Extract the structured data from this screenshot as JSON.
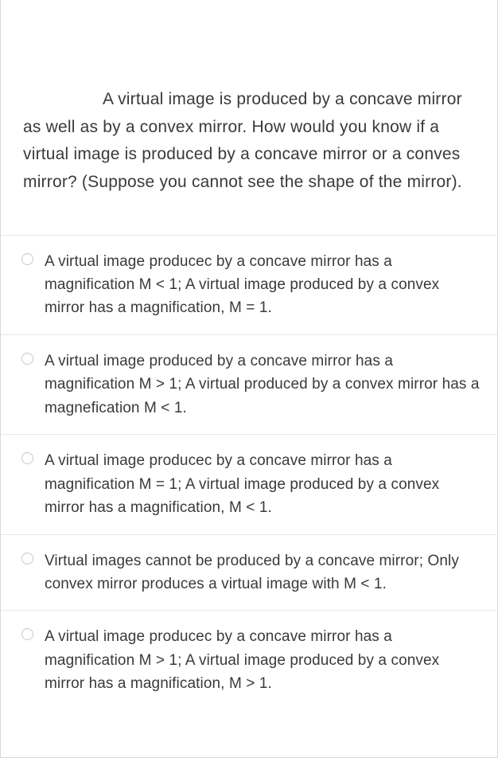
{
  "question": {
    "text": "A virtual image is produced by a concave mirror as well as by a convex mirror. How would you know if a virtual image is produced by a concave mirror or a conves mirror? (Suppose you cannot see the shape of the mirror)."
  },
  "options": [
    {
      "text": "A virtual image producec by a concave mirror has a magnification M < 1; A virtual image produced by a convex mirror has a magnification, M = 1."
    },
    {
      "text": "A virtual image produced by a concave mirror has a magnification M > 1; A virtual produced by a convex mirror has a magnefication M < 1."
    },
    {
      "text": "A virtual image producec by a concave mirror has a magnification M = 1; A virtual image produced by a convex mirror has a magnification, M < 1."
    },
    {
      "text": "Virtual images cannot be produced by a concave mirror; Only convex mirror produces a virtual image with M < 1."
    },
    {
      "text": "A virtual image producec by a concave mirror has a magnification M > 1; A virtual image produced by a convex mirror has a magnification, M > 1."
    }
  ]
}
